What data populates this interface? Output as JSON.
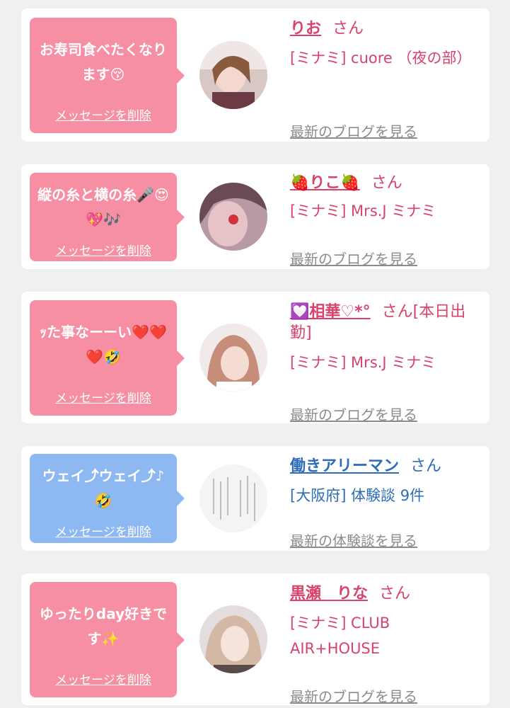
{
  "cards": [
    {
      "message": "お寿司食べたくなります😚",
      "delete_label": "メッセージを削除",
      "name": "りお",
      "san": "さん",
      "shop": "[ミナミ] cuore （夜の部）",
      "link": "最新のブログを見る"
    },
    {
      "message": "縦の糸と横の糸🎤😍💖🎶",
      "delete_label": "メッセージを削除",
      "name": "🍓りこ🍓",
      "san": "さん",
      "shop": "[ミナミ] Mrs.J ミナミ",
      "link": "最新のブログを見る"
    },
    {
      "message": "ｯた事なーーい❤️❤️❤️🤣",
      "delete_label": "メッセージを削除",
      "name": "💟相華♡*°",
      "san": "さん[本日出勤]",
      "shop": "[ミナミ] Mrs.J ミナミ",
      "link": "最新のブログを見る"
    },
    {
      "message": "ウェイ⤴︎ウェイ⤴︎♪🤣",
      "delete_label": "メッセージを削除",
      "name": "働きアリーマン",
      "san": "さん",
      "shop": "[大阪府] 体験談 9件",
      "link": "最新の体験談を見る"
    },
    {
      "message": "ゆったりday好きです✨",
      "delete_label": "メッセージを削除",
      "name": "黒瀬　りな",
      "san": "さん",
      "shop": "[ミナミ] CLUB AIR+HOUSE",
      "link": "最新のブログを見る"
    }
  ],
  "colors": {
    "pink_bubble": "#f68fa3",
    "blue_bubble": "#8db8f2",
    "pink_text": "#d9426a",
    "blue_text": "#2c6cb8",
    "link_gray": "#8c8c8c"
  },
  "icons": [
    "avatar-photo"
  ]
}
